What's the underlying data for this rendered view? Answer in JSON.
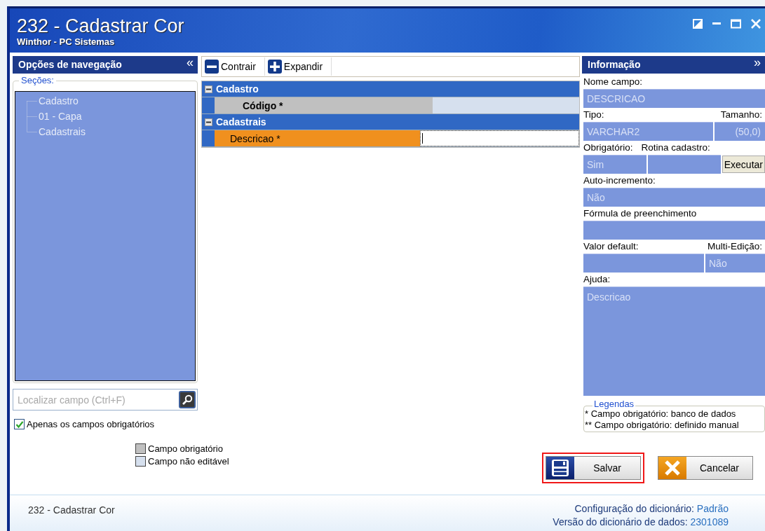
{
  "window": {
    "title": "232 - Cadastrar Cor",
    "subtitle": "Winthor - PC Sistemas"
  },
  "navigation": {
    "title": "Opções de navegação",
    "collapse_glyph": "«"
  },
  "sections": {
    "label": "Seções:",
    "items": [
      {
        "label": "Cadastro"
      },
      {
        "label": "01 - Capa"
      },
      {
        "label": "Cadastrais"
      }
    ]
  },
  "search": {
    "placeholder": "Localizar campo (Ctrl+F)"
  },
  "required_only": {
    "label": "Apenas os campos obrigatórios",
    "checked": true
  },
  "swatches": [
    {
      "label": "Campo obrigatório",
      "color": "#c0c0c0"
    },
    {
      "label": "Campo não editável",
      "color": "#d6e0ee"
    }
  ],
  "toolbar": [
    {
      "label": "Contrair",
      "kind": "collapse"
    },
    {
      "label": "Expandir",
      "kind": "expand"
    }
  ],
  "groups": [
    {
      "title": "Cadastro",
      "expanded": true,
      "fields": [
        {
          "label": "Código *",
          "selected": false,
          "editable": false
        }
      ]
    },
    {
      "title": "Cadastrais",
      "expanded": true,
      "fields": [
        {
          "label": "Descricao *",
          "selected": true,
          "editable": true
        }
      ]
    }
  ],
  "info": {
    "title": "Informação",
    "expand_glyph": "»",
    "name_label": "Nome campo:",
    "name_value": "DESCRICAO",
    "type_label": "Tipo:",
    "type_value": "VARCHAR2",
    "size_label": "Tamanho:",
    "size_value": "(50,0)",
    "required_label": "Obrigatório:",
    "required_value": "Sim",
    "routine_label": "Rotina cadastro:",
    "execute_button": "Executar",
    "autoinc_label": "Auto-incremento:",
    "autoinc_value": "Não",
    "formula_label": "Fórmula de preenchimento",
    "default_label": "Valor default:",
    "multi_label": "Multi-Edição:",
    "multi_value": "Não",
    "help_label": "Ajuda:",
    "help_value": "Descricao"
  },
  "legend": {
    "title": "Legendas",
    "lines": [
      "* Campo obrigatório: banco de dados",
      "** Campo obrigatório: definido manual"
    ]
  },
  "buttons": [
    {
      "label": "Salvar",
      "kind": "save",
      "highlighted": true
    },
    {
      "label": "Cancelar",
      "kind": "cancel",
      "highlighted": false
    }
  ],
  "status_bar": {
    "routine": "232 - Cadastrar Cor",
    "config_label": "Configuração do dicionário:",
    "config_value": "Padrão",
    "version_label": "Versão do dicionário de dados:",
    "version_value": "2301089"
  }
}
